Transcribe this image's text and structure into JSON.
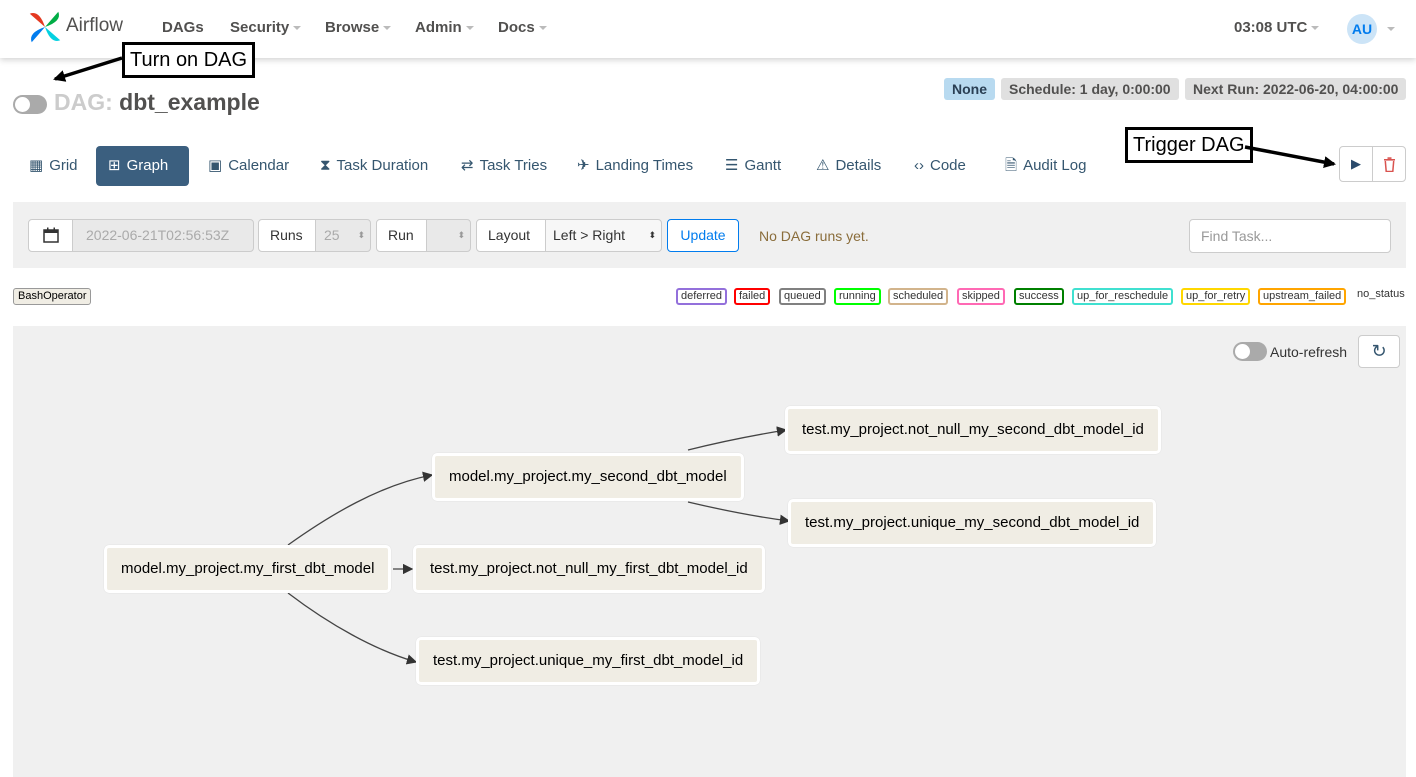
{
  "navbar": {
    "brand": "Airflow",
    "items": [
      "DAGs",
      "Security",
      "Browse",
      "Admin",
      "Docs"
    ],
    "clock": "03:08 UTC",
    "user_initials": "AU"
  },
  "annotations": {
    "turn_on": "Turn on DAG",
    "trigger": "Trigger DAG"
  },
  "dag": {
    "prefix": "DAG:",
    "name": "dbt_example",
    "status_badge": "None",
    "schedule": "Schedule: 1 day, 0:00:00",
    "next_run": "Next Run: 2022-06-20, 04:00:00"
  },
  "tabs": {
    "grid": "Grid",
    "graph": "Graph",
    "calendar": "Calendar",
    "task_duration": "Task Duration",
    "task_tries": "Task Tries",
    "landing_times": "Landing Times",
    "gantt": "Gantt",
    "details": "Details",
    "code": "Code",
    "audit_log": "Audit Log"
  },
  "controls": {
    "date_value": "2022-06-21T02:56:53Z",
    "runs_label": "Runs",
    "runs_value": "25",
    "run_label": "Run",
    "layout_label": "Layout",
    "layout_value": "Left > Right",
    "update_label": "Update",
    "no_runs_message": "No DAG runs yet.",
    "find_task_placeholder": "Find Task..."
  },
  "legend": {
    "operator": "BashOperator",
    "states": [
      {
        "label": "deferred",
        "color": "#9370db"
      },
      {
        "label": "failed",
        "color": "#ff0000"
      },
      {
        "label": "queued",
        "color": "#808080"
      },
      {
        "label": "running",
        "color": "#00ff00"
      },
      {
        "label": "scheduled",
        "color": "#d2b48c"
      },
      {
        "label": "skipped",
        "color": "#ff69b4"
      },
      {
        "label": "success",
        "color": "#008000"
      },
      {
        "label": "up_for_reschedule",
        "color": "#40e0d0"
      },
      {
        "label": "up_for_retry",
        "color": "#ffd700"
      },
      {
        "label": "upstream_failed",
        "color": "#ffa500"
      },
      {
        "label": "no_status",
        "color": ""
      }
    ]
  },
  "graph": {
    "auto_refresh_label": "Auto-refresh",
    "nodes": [
      "model.my_project.my_first_dbt_model",
      "model.my_project.my_second_dbt_model",
      "test.my_project.not_null_my_first_dbt_model_id",
      "test.my_project.unique_my_first_dbt_model_id",
      "test.my_project.not_null_my_second_dbt_model_id",
      "test.my_project.unique_my_second_dbt_model_id"
    ]
  }
}
